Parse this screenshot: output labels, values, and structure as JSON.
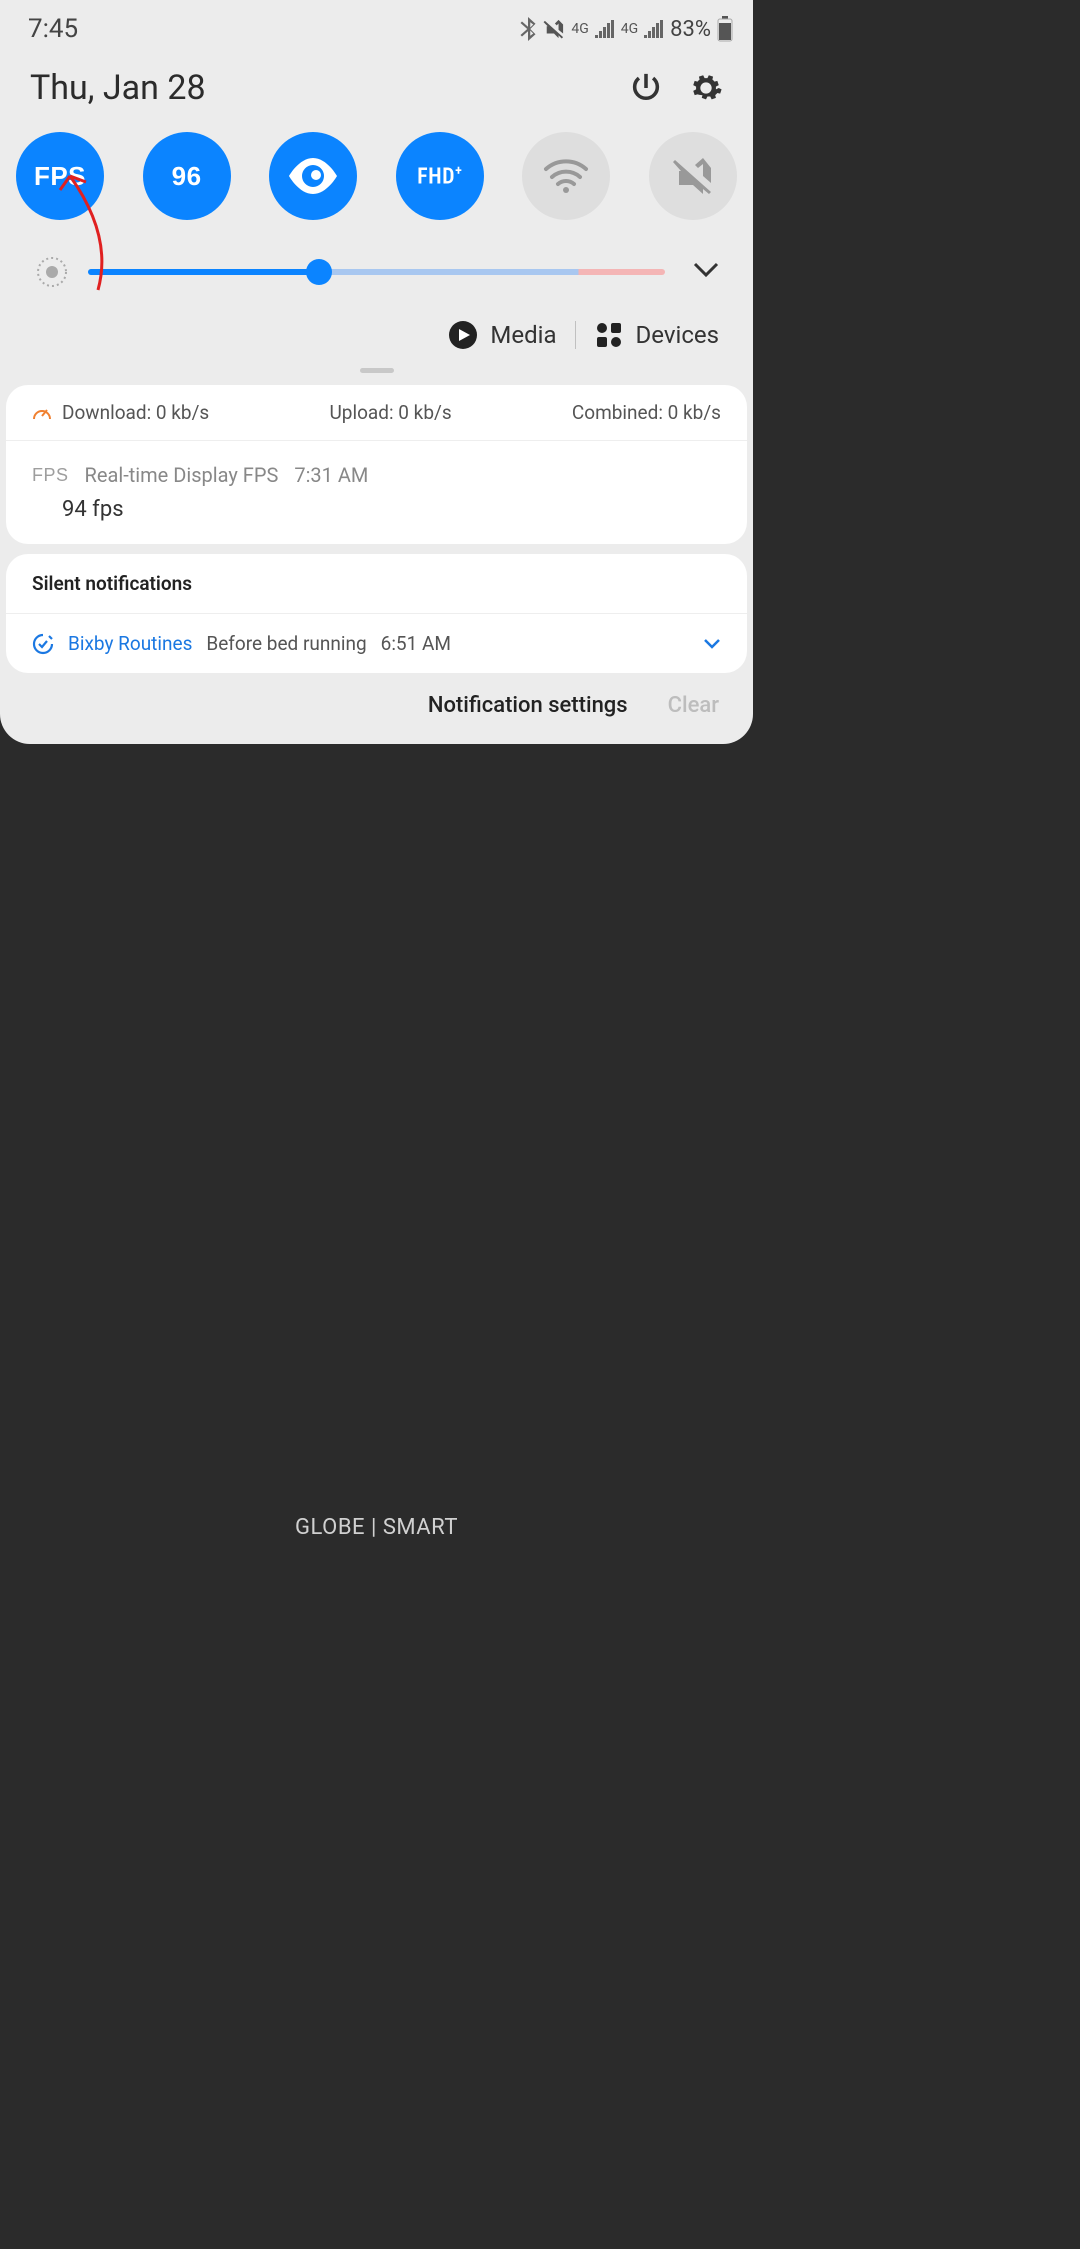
{
  "status": {
    "time": "7:45",
    "battery_pct": "83%",
    "net_label_1": "4G",
    "net_label_2": "4G"
  },
  "header": {
    "date": "Thu, Jan 28"
  },
  "quick_settings": [
    {
      "label": "FPS",
      "active": true,
      "type": "text"
    },
    {
      "label": "96",
      "active": true,
      "type": "text"
    },
    {
      "label": "eye",
      "active": true,
      "type": "icon"
    },
    {
      "label": "FHD",
      "active": true,
      "type": "fhd"
    },
    {
      "label": "wifi",
      "active": false,
      "type": "icon"
    },
    {
      "label": "mute",
      "active": false,
      "type": "icon"
    }
  ],
  "brightness_pct": 40,
  "controls": {
    "media": "Media",
    "devices": "Devices"
  },
  "network_speed": {
    "download": "Download: 0 kb/s",
    "upload": "Upload: 0 kb/s",
    "combined": "Combined: 0 kb/s"
  },
  "fps_notif": {
    "tag": "FPS",
    "title": "Real-time Display FPS",
    "time": "7:31 AM",
    "value": "94 fps"
  },
  "silent_header": "Silent notifications",
  "bixby": {
    "name": "Bixby Routines",
    "desc": "Before bed running",
    "time": "6:51 AM"
  },
  "footer": {
    "settings": "Notification settings",
    "clear": "Clear"
  },
  "carrier": "GLOBE | SMART"
}
